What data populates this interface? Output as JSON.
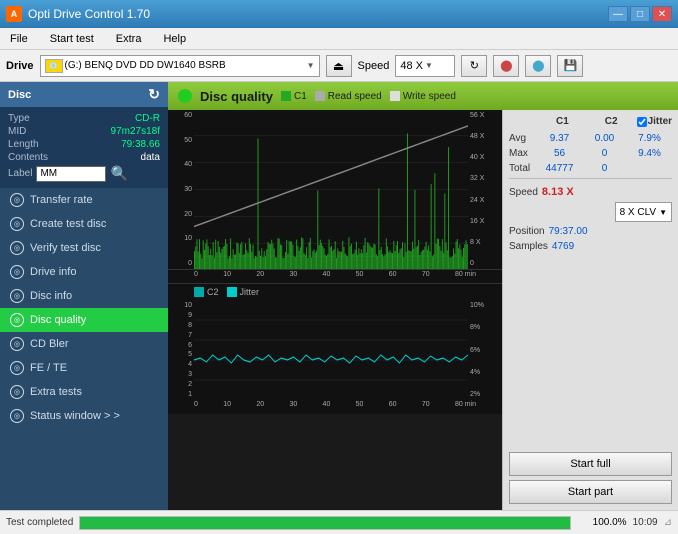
{
  "app": {
    "title": "Opti Drive Control 1.70",
    "icon": "A"
  },
  "title_controls": {
    "minimize": "—",
    "maximize": "□",
    "close": "✕"
  },
  "menu": {
    "items": [
      "File",
      "Start test",
      "Extra",
      "Help"
    ]
  },
  "drive_bar": {
    "label": "Drive",
    "drive_text": "(G:)  BENQ DVD DD DW1640 BSRB",
    "speed_label": "Speed",
    "speed_value": "48 X"
  },
  "sidebar": {
    "disc_header": "Disc",
    "disc_fields": [
      {
        "key": "Type",
        "val": "CD-R"
      },
      {
        "key": "MID",
        "val": "97m27s18f"
      },
      {
        "key": "Length",
        "val": "79:38.66"
      },
      {
        "key": "Contents",
        "val": "data"
      },
      {
        "key": "Label",
        "val": "MM"
      }
    ],
    "nav_items": [
      {
        "id": "transfer-rate",
        "label": "Transfer rate"
      },
      {
        "id": "create-test-disc",
        "label": "Create test disc"
      },
      {
        "id": "verify-test-disc",
        "label": "Verify test disc"
      },
      {
        "id": "drive-info",
        "label": "Drive info"
      },
      {
        "id": "disc-info",
        "label": "Disc info"
      },
      {
        "id": "disc-quality",
        "label": "Disc quality",
        "active": true
      },
      {
        "id": "cd-bler",
        "label": "CD Bler"
      },
      {
        "id": "fe-te",
        "label": "FE / TE"
      },
      {
        "id": "extra-tests",
        "label": "Extra tests"
      },
      {
        "id": "status-window",
        "label": "Status window > >"
      }
    ]
  },
  "chart": {
    "title": "Disc quality",
    "legend": [
      {
        "color": "#22aa22",
        "label": "C1"
      },
      {
        "color": "#aaaaaa",
        "label": "Read speed"
      },
      {
        "color": "#dddddd",
        "label": "Write speed"
      }
    ],
    "legend2": [
      {
        "color": "#00cccc",
        "label": "C2"
      },
      {
        "color": "#00aacc",
        "label": "Jitter"
      }
    ],
    "top_y_labels": [
      "60",
      "50",
      "40",
      "30",
      "20",
      "10"
    ],
    "top_y_right": [
      "56 X",
      "48 X",
      "40 X",
      "32 X",
      "24 X",
      "16 X",
      "8 X",
      "0"
    ],
    "bottom_y_labels": [
      "10",
      "9",
      "8",
      "7",
      "6",
      "5",
      "4",
      "3",
      "2",
      "1"
    ],
    "bottom_y_right": [
      "10%",
      "8%",
      "6%",
      "4%",
      "2%"
    ],
    "x_labels": [
      "0",
      "10",
      "20",
      "30",
      "40",
      "50",
      "60",
      "70",
      "80"
    ],
    "x_unit": "min"
  },
  "stats": {
    "columns": [
      "C1",
      "C2",
      "Jitter"
    ],
    "rows": [
      {
        "label": "Avg",
        "c1": "9.37",
        "c2": "0.00",
        "jitter": "7.9%"
      },
      {
        "label": "Max",
        "c1": "56",
        "c2": "0",
        "jitter": "9.4%"
      },
      {
        "label": "Total",
        "c1": "44777",
        "c2": "0",
        "jitter": ""
      }
    ],
    "jitter_checked": true,
    "speed_label": "Speed",
    "speed_value": "8.13 X",
    "speed_mode": "8 X CLV",
    "position_label": "Position",
    "position_value": "79:37.00",
    "samples_label": "Samples",
    "samples_value": "4769",
    "btn_start_full": "Start full",
    "btn_start_part": "Start part"
  },
  "status_bar": {
    "text": "Test completed",
    "progress": 100,
    "progress_text": "100.0%",
    "time": "10:09"
  }
}
